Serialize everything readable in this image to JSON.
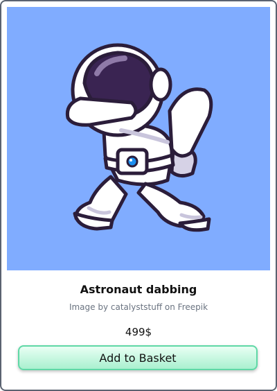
{
  "product": {
    "image_icon": "astronaut-dabbing-illustration",
    "title": "Astronaut dabbing",
    "credit": "Image by catalyststuff on Freepik",
    "price": "499$",
    "add_button_label": "Add to Basket"
  },
  "colors": {
    "image_background": "#80acff",
    "button_border": "#5fd8a6",
    "button_fill": "#a9f0cf",
    "card_border": "#5a6270"
  }
}
